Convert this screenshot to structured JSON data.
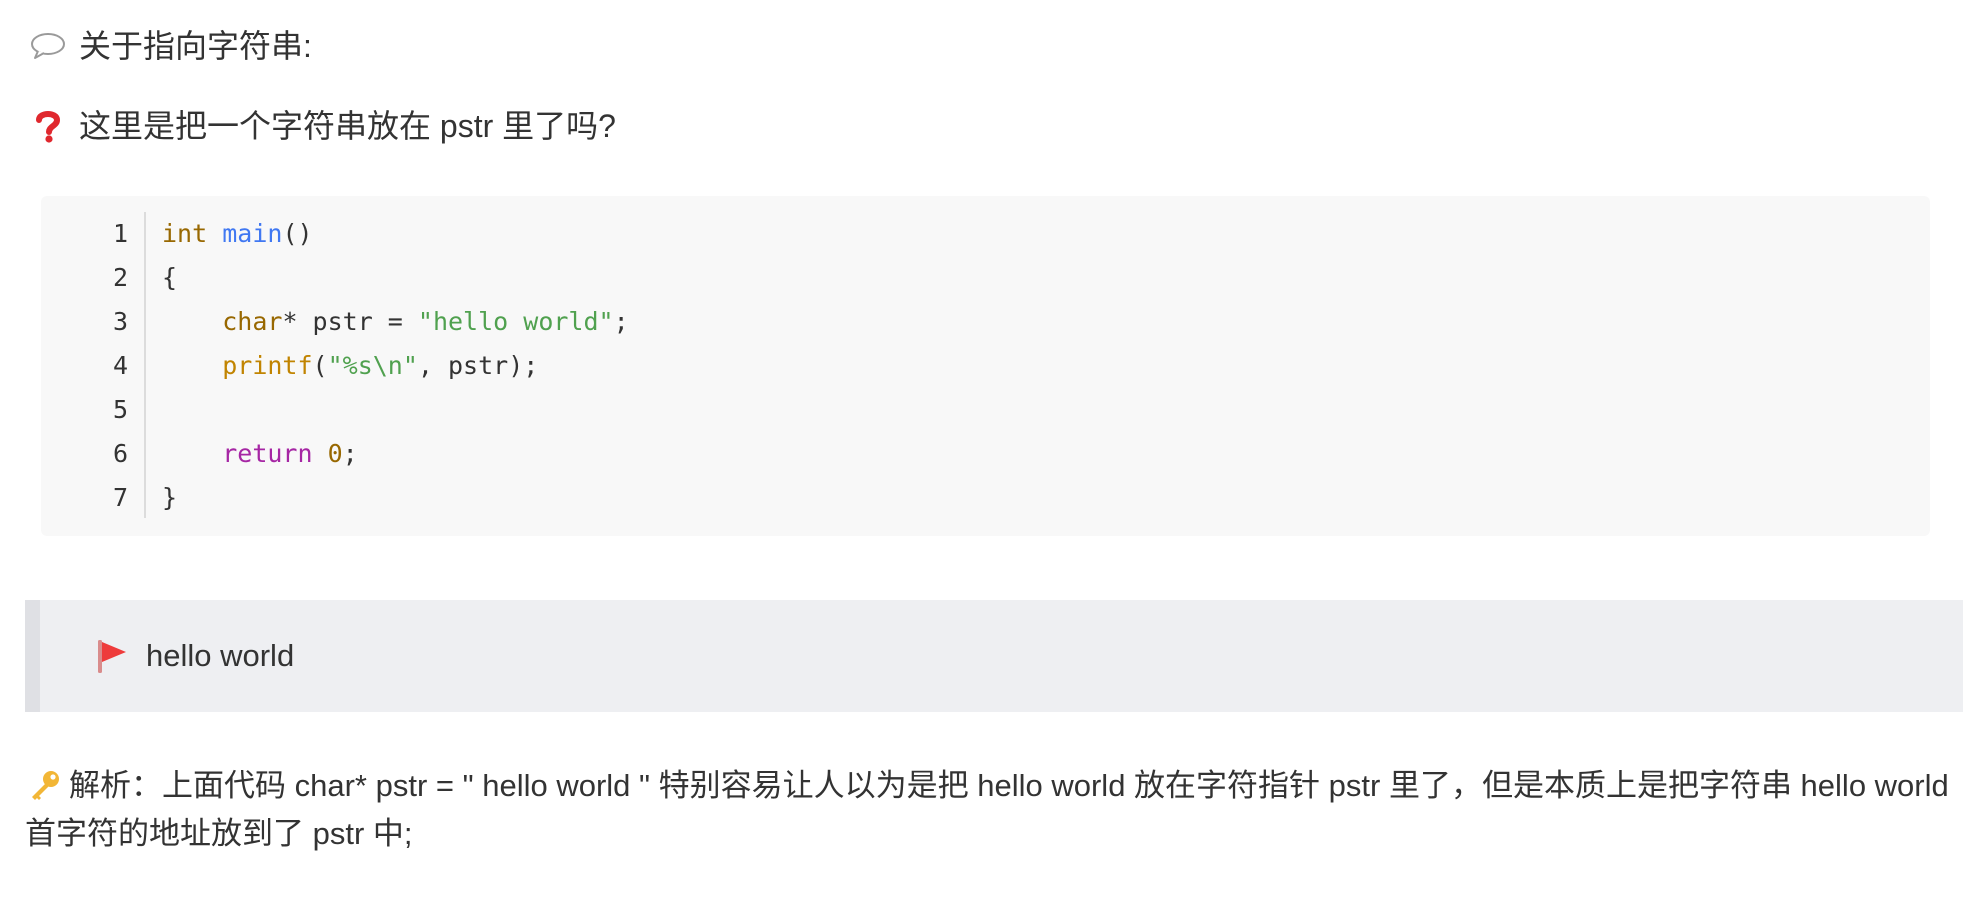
{
  "heading": {
    "icon": "speech-bubble-icon",
    "text": "关于指向字符串:"
  },
  "question": {
    "icon": "red-question-mark-icon",
    "text": "这里是把一个字符串放在 pstr 里了吗?"
  },
  "code": {
    "line_numbers": [
      "1",
      "2",
      "3",
      "4",
      "5",
      "6",
      "7"
    ],
    "lines": [
      [
        {
          "t": "int",
          "c": "type"
        },
        {
          "t": " ",
          "c": ""
        },
        {
          "t": "main",
          "c": "fn"
        },
        {
          "t": "()",
          "c": ""
        }
      ],
      [
        {
          "t": "{",
          "c": ""
        }
      ],
      [
        {
          "t": "    ",
          "c": ""
        },
        {
          "t": "char",
          "c": "type"
        },
        {
          "t": "* pstr = ",
          "c": ""
        },
        {
          "t": "\"hello world\"",
          "c": "str"
        },
        {
          "t": ";",
          "c": ""
        }
      ],
      [
        {
          "t": "    ",
          "c": ""
        },
        {
          "t": "printf",
          "c": "call"
        },
        {
          "t": "(",
          "c": ""
        },
        {
          "t": "\"%s\\n\"",
          "c": "str"
        },
        {
          "t": ", pstr);",
          "c": ""
        }
      ],
      [],
      [
        {
          "t": "    ",
          "c": ""
        },
        {
          "t": "return",
          "c": "kw"
        },
        {
          "t": " ",
          "c": ""
        },
        {
          "t": "0",
          "c": "num"
        },
        {
          "t": ";",
          "c": ""
        }
      ],
      [
        {
          "t": "}",
          "c": ""
        }
      ]
    ]
  },
  "output": {
    "icon": "red-flag-icon",
    "text": "hello world"
  },
  "analysis": {
    "icon": "key-icon",
    "text": "解析：上面代码 char* pstr = \" hello world \"  特别容易让人以为是把 hello world 放在字符指针 pstr 里了，但是本质上是把字符串 hello world 首字符的地址放到了 pstr 中;"
  }
}
